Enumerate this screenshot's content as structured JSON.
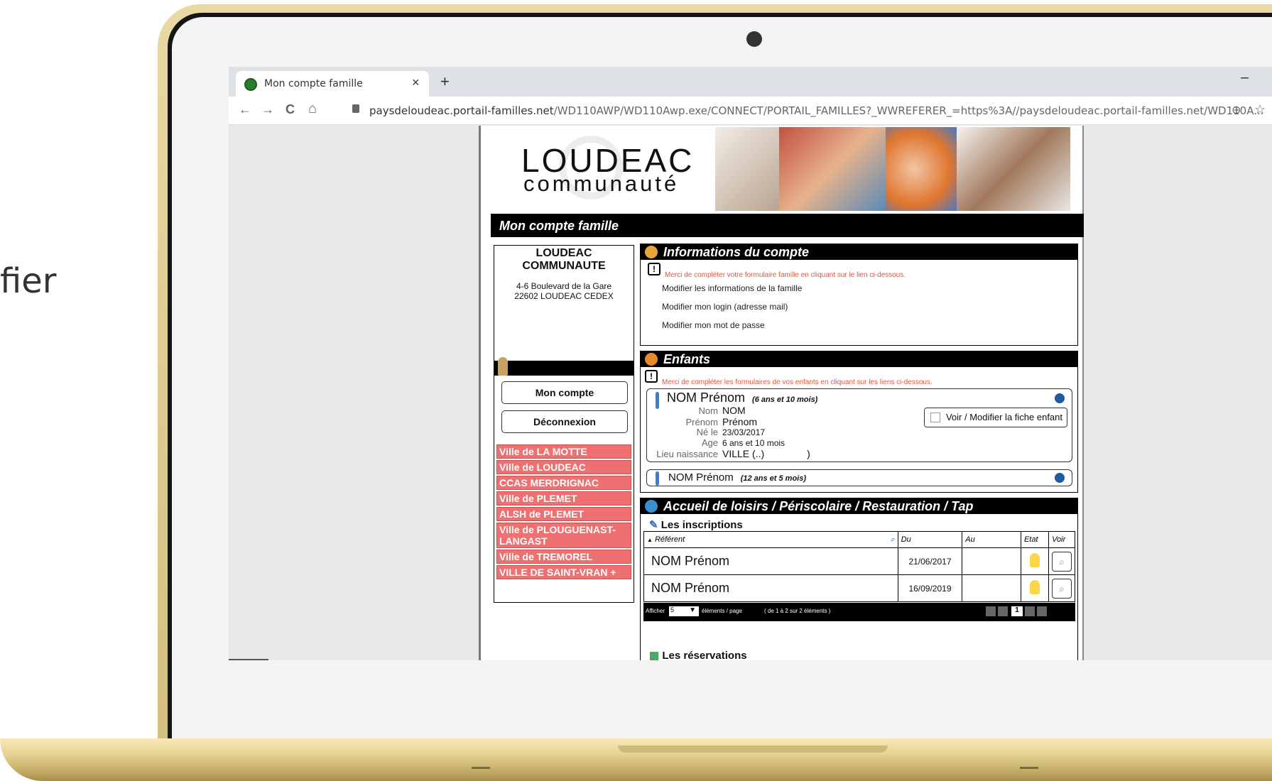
{
  "background_text": "fier",
  "browser": {
    "tab_title": "Mon compte famille",
    "tab_close": "×",
    "new_tab": "+",
    "minimize": "–",
    "back": "←",
    "forward": "→",
    "reload": "C",
    "home": "⌂",
    "url_domain": "paysdeloudeac.portail-familles.net",
    "url_path": "/WD110AWP/WD110Awp.exe/CONNECT/PORTAIL_FAMILLES?_WWREFERER_=https%3A//paysdeloudeac.portail-familles.net/WD110A...",
    "zoom_icon": "⊖",
    "star_icon": "☆"
  },
  "header": {
    "logo_line1": "LOUDEAC",
    "logo_line2": "communauté",
    "page_title": "Mon compte famille"
  },
  "org": {
    "name": "LOUDEAC COMMUNAUTE",
    "address1": "4-6 Boulevard de la Gare",
    "address2": "22602 LOUDEAC CEDEX"
  },
  "menu": {
    "mon_compte": "Mon compte",
    "deconnexion": "Déconnexion",
    "villes": [
      "Ville de LA MOTTE",
      "Ville de LOUDEAC",
      "CCAS MERDRIGNAC",
      "Ville de PLEMET",
      "ALSH de PLEMET",
      "Ville de PLOUGUENAST-LANGAST",
      "Ville de TREMOREL",
      "VILLE DE SAINT-VRAN +"
    ]
  },
  "infos": {
    "title": "Informations du compte",
    "warning": "Merci de compléter votre formulaire famille en cliquant sur le lien ci-dessous.",
    "links": [
      "Modifier les informations de la famille",
      "Modifier mon login (adresse mail)",
      "Modifier mon mot de passe"
    ]
  },
  "enfants": {
    "title": "Enfants",
    "warning": "Merci de compléter les formulaires de vos enfants en cliquant sur les liens ci-dessous.",
    "child1": {
      "name": "NOM Prénom",
      "age": "(6 ans et 10 mois)",
      "labels": [
        "Nom",
        "Prénom",
        "Né le",
        "Age",
        "Lieu naissance"
      ],
      "values": [
        "NOM",
        "Prénom",
        "23/03/2017",
        "6 ans et 10 mois",
        "VILLE (..)"
      ],
      "closing": ")",
      "button": "Voir / Modifier la fiche enfant"
    },
    "child2": {
      "name": "NOM Prénom",
      "age": "(12 ans et 5 mois)"
    }
  },
  "accueil": {
    "title": "Accueil de loisirs / Périscolaire / Restauration / Tap",
    "inscriptions_title": "Les inscriptions",
    "columns": [
      "Référent",
      "Du",
      "Au",
      "Etat",
      "Voir"
    ],
    "sort_arrow": "▲",
    "rows": [
      {
        "referent": "NOM Prénom",
        "du": "21/06/2017",
        "au": ""
      },
      {
        "referent": "NOM Prénom",
        "du": "16/09/2019",
        "au": ""
      }
    ],
    "pager_show": "Afficher",
    "pager_value": "5",
    "pager_per_page": "éléments / page",
    "pager_info": "( de 1 à 2 sur 2 éléments )",
    "pager_current": "1",
    "reservations_title": "Les réservations"
  }
}
